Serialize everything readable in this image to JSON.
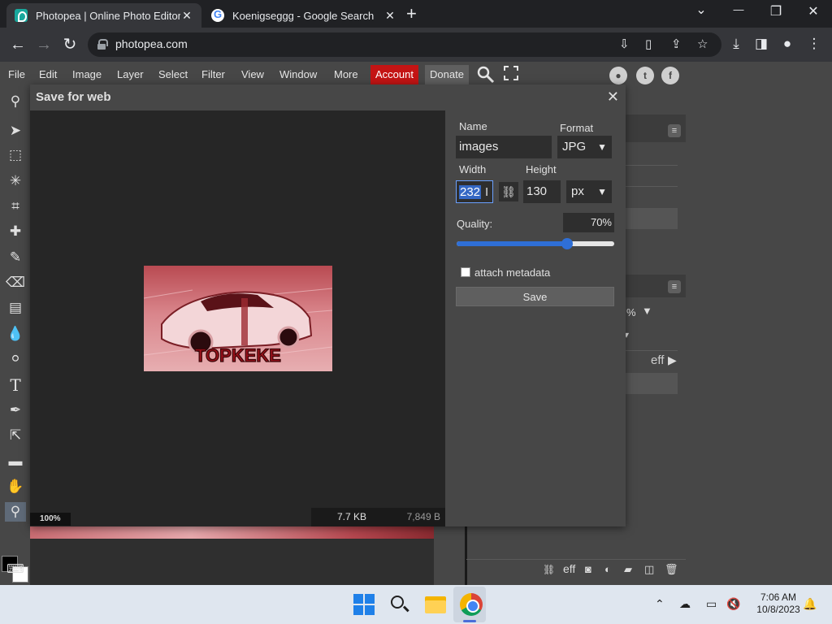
{
  "browser": {
    "tabs": [
      {
        "title": "Photopea | Online Photo Editor",
        "active": true
      },
      {
        "title": "Koenigseggg - Google Search",
        "active": false
      }
    ],
    "new_tab": "+",
    "url": "photopea.com",
    "window_controls": {
      "list": "⌄",
      "minimize": "—",
      "restore": "❐",
      "close": "✕"
    }
  },
  "menubar": {
    "items": [
      "File",
      "Edit",
      "Image",
      "Layer",
      "Select",
      "Filter",
      "View",
      "Window",
      "More"
    ],
    "account": "Account",
    "donate": "Donate",
    "social": [
      "reddit-icon",
      "twitter-icon",
      "facebook-icon"
    ]
  },
  "dialog": {
    "title": "Save for web",
    "close": "✕",
    "preview": {
      "image_text": "TOPKEKE",
      "zoom": "100%",
      "size_kb": "7.7 KB",
      "size_bytes": "7,849 B"
    },
    "settings": {
      "name_label": "Name",
      "name_value": "images",
      "format_label": "Format",
      "format_value": "JPG",
      "width_label": "Width",
      "width_value": "232",
      "height_label": "Height",
      "height_value": "130",
      "unit_value": "px",
      "quality_label": "Quality:",
      "quality_value": "70%",
      "quality_fraction": 0.7,
      "metadata_label": "attach metadata",
      "save_label": "Save"
    }
  },
  "right_panel": {
    "pct_fragment": "%",
    "eff_label": "eff",
    "eff_label2": "eff"
  },
  "taskbar": {
    "time": "7:06 AM",
    "date": "10/8/2023"
  },
  "colors": {
    "accent": "#2f6fd6",
    "account_red": "#c41414",
    "photopea_bg": "#474747"
  }
}
